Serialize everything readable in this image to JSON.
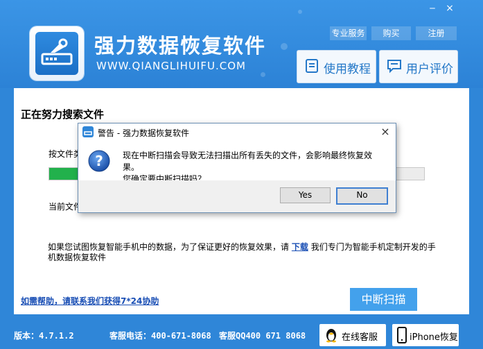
{
  "window": {
    "minimize": "‒",
    "close": "×"
  },
  "app": {
    "title": "强力数据恢复软件",
    "url": "WWW.QIANGLIHUIFU.COM"
  },
  "top_links": [
    "专业服务",
    "购买",
    "注册"
  ],
  "header_buttons": {
    "tutorial": "使用教程",
    "review": "用户评价"
  },
  "content": {
    "heading": "正在努力搜索文件",
    "by_type_label": "按文件类",
    "progress_fraction": 0.08,
    "current_label": "当前文件",
    "tip_before": "如果您试图恢复智能手机中的数据，为了保证更好的恢复效果，请",
    "tip_link": "下载",
    "tip_after": "我们专门为智能手机定制开发的手机数据恢复软件",
    "help_link": "如需帮助，请联系我们获得7*24协助",
    "stop_button": "中断扫描"
  },
  "footer": {
    "version": "版本：4.7.1.2",
    "phone": "客服电话：400-671-8068",
    "qq": "客服QQ400 671 8068",
    "online_service": "在线客服",
    "iphone_recovery": "iPhone恢复"
  },
  "dialog": {
    "title": "警告 - 强力数据恢复软件",
    "close": "×",
    "message_line1": "现在中断扫描会导致无法扫描出所有丢失的文件，会影响最终恢复效果。",
    "message_line2": "您确定要中断扫描吗？",
    "yes": "Yes",
    "no": "No"
  },
  "colors": {
    "header_blue": "#2f86d8",
    "progress_green": "#22b14c",
    "stop_button": "#43a1ec"
  }
}
